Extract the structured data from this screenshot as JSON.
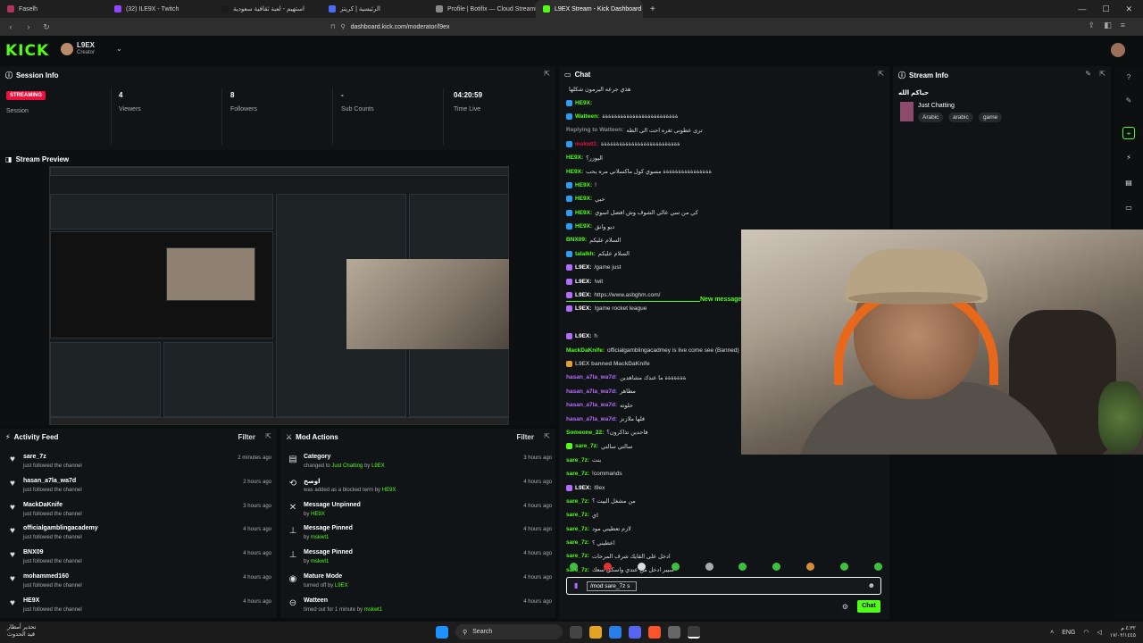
{
  "browser": {
    "tabs": [
      {
        "label": "Faselh",
        "active": false,
        "color": "#b0345e"
      },
      {
        "label": "(32) ILE9X - Twitch",
        "active": false,
        "color": "#9146ff"
      },
      {
        "label": "استهيم - لعبة ثقافية سعودية",
        "active": false,
        "color": "#1a1a1a"
      },
      {
        "label": "الرئيسية | كريتز",
        "active": false,
        "color": "#4a6cf7"
      },
      {
        "label": "Profile | Botifix — Cloud Streaming B",
        "active": false,
        "color": "#888888"
      },
      {
        "label": "L9EX Stream - Kick Dashboard",
        "active": true,
        "color": "#53fc18"
      }
    ],
    "url": "dashboard.kick.com/moderator/l9ex"
  },
  "header": {
    "logo": "KICK",
    "username": "L9EX",
    "role": "Creator"
  },
  "session": {
    "title": "Session Info",
    "badge": "STREAMING",
    "session_label": "Session",
    "stats": [
      {
        "value": "4",
        "label": "Viewers"
      },
      {
        "value": "8",
        "label": "Followers"
      },
      {
        "value": "-",
        "label": "Sub Counts"
      },
      {
        "value": "04:20:59",
        "label": "Time Live"
      }
    ]
  },
  "preview": {
    "title": "Stream Preview"
  },
  "activity": {
    "title": "Activity Feed",
    "filter": "Filter",
    "items": [
      {
        "name": "sare_7z",
        "action": "just followed the channel",
        "time": "2 minutes ago"
      },
      {
        "name": "hasan_a7la_wa7d",
        "action": "just followed the channel",
        "time": "2 hours ago"
      },
      {
        "name": "MackDaKnife",
        "action": "just followed the channel",
        "time": "3 hours ago"
      },
      {
        "name": "officialgamblingacademy",
        "action": "just followed the channel",
        "time": "4 hours ago"
      },
      {
        "name": "BNX09",
        "action": "just followed the channel",
        "time": "4 hours ago"
      },
      {
        "name": "mohammed160",
        "action": "just followed the channel",
        "time": "4 hours ago"
      },
      {
        "name": "HE9X",
        "action": "just followed the channel",
        "time": "4 hours ago"
      }
    ]
  },
  "modactions": {
    "title": "Mod Actions",
    "filter": "Filter",
    "items": [
      {
        "icon": "▤",
        "title": "Category",
        "pre": "changed to",
        "hl": "Just Chatting",
        "mid": "by",
        "by": "L9EX",
        "time": "3 hours ago"
      },
      {
        "icon": "⟲",
        "title": "اوصخ",
        "pre": "was added as a blocked term by",
        "hl": "",
        "mid": "",
        "by": "HE9X",
        "time": "4 hours ago"
      },
      {
        "icon": "✕",
        "title": "Message Unpinned",
        "pre": "by",
        "hl": "",
        "mid": "",
        "by": "HE9X",
        "time": "4 hours ago"
      },
      {
        "icon": "⊥",
        "title": "Message Pinned",
        "pre": "by",
        "hl": "",
        "mid": "",
        "by": "mskwt1",
        "time": "4 hours ago"
      },
      {
        "icon": "⊥",
        "title": "Message Pinned",
        "pre": "by",
        "hl": "",
        "mid": "",
        "by": "mskwt1",
        "time": "4 hours ago"
      },
      {
        "icon": "◉",
        "title": "Mature Mode",
        "pre": "turned off by",
        "hl": "",
        "mid": "",
        "by": "L9EX",
        "time": "4 hours ago"
      },
      {
        "icon": "⊖",
        "title": "Watteen",
        "pre": "timed out for 1 minute by",
        "hl": "",
        "mid": "",
        "by": "mskwt1",
        "time": "4 hours ago"
      }
    ]
  },
  "chat": {
    "title": "Chat",
    "new_messages": "New messages",
    "lines": [
      {
        "user": "",
        "color": "#dddddd",
        "text": "هذي جرعه اليرمون شكلها",
        "badge": ""
      },
      {
        "user": "HE9X:",
        "color": "#53fc18",
        "text": "",
        "badge": "#2a9df4"
      },
      {
        "user": "Watteen:",
        "color": "#53fc18",
        "text": "ةةةةةةةةةةةةةةةةةةةةةةةةة",
        "badge": "#2a9df4"
      },
      {
        "user": "Replying to Watteen:",
        "color": "#888888",
        "text": "ترى عطونى ثغره احت الى الطه",
        "badge": ""
      },
      {
        "user": "mskwt1:",
        "color": "#e9113c",
        "text": "ةةةةةةةةةةةةةةةةةةةةةةةةةة",
        "badge": "#2a9df4"
      },
      {
        "user": "HE9X:",
        "color": "#53fc18",
        "text": "اليوزر؟",
        "badge": ""
      },
      {
        "user": "HE9X:",
        "color": "#53fc18",
        "text": "ةةةةةةةةةةةةةةةة مسوي كول ماكسلاني مره يحب",
        "badge": ""
      },
      {
        "user": "HE9X:",
        "color": "#53fc18",
        "text": "!",
        "badge": "#2a9df4"
      },
      {
        "user": "HE9X:",
        "color": "#53fc18",
        "text": "حبي",
        "badge": "#2a9df4"
      },
      {
        "user": "HE9X:",
        "color": "#53fc18",
        "text": "كي من سي عالي الشوف وش افضل اسوي",
        "badge": "#2a9df4"
      },
      {
        "user": "HE9X:",
        "color": "#53fc18",
        "text": "ديو وانق",
        "badge": "#2a9df4"
      },
      {
        "user": "BNX09:",
        "color": "#53fc18",
        "text": "السلام عليكم",
        "badge": ""
      },
      {
        "user": "talalkh:",
        "color": "#53fc18",
        "text": "السلام عليكم",
        "badge": "#2a9df4"
      },
      {
        "user": "L9EX:",
        "color": "#ffffff",
        "text": "/game just",
        "badge": "#b46cff"
      },
      {
        "user": "L9EX:",
        "color": "#ffffff",
        "text": "!wit",
        "badge": "#b46cff"
      },
      {
        "user": "L9EX:",
        "color": "#ffffff",
        "text": "https://www.asbghm.com/",
        "badge": "#b46cff"
      },
      {
        "user": "L9EX:",
        "color": "#ffffff",
        "text": "!game rocket league",
        "badge": "#b46cff"
      },
      {
        "user": "",
        "color": "#dddddd",
        "text": "",
        "badge": ""
      },
      {
        "user": "L9EX:",
        "color": "#ffffff",
        "text": "h",
        "badge": "#b46cff"
      },
      {
        "user": "MackDaKnife:",
        "color": "#53fc18",
        "text": "officialgamblingacadmey is live come see (Banned)",
        "badge": ""
      },
      {
        "user": "L9EX banned MackDaKnife",
        "color": "#aaaaaa",
        "text": "",
        "badge": "#e0a030"
      },
      {
        "user": "hasan_a7la_wa7d:",
        "color": "#b46cff",
        "text": "ةةةةةةة ما عندك مشاهدين",
        "badge": ""
      },
      {
        "user": "hasan_a7la_wa7d:",
        "color": "#b46cff",
        "text": "مطاهر",
        "badge": ""
      },
      {
        "user": "hasan_a7la_wa7d:",
        "color": "#b46cff",
        "text": "حلوته",
        "badge": ""
      },
      {
        "user": "hasan_a7la_wa7d:",
        "color": "#b46cff",
        "text": "قلها ملازنز",
        "badge": ""
      },
      {
        "user": "Someone_22:",
        "color": "#53fc18",
        "text": "فاحدين تذاكرون؟",
        "badge": ""
      },
      {
        "user": "sare_7z:",
        "color": "#53fc18",
        "text": "سالتي سالتي",
        "badge": "#53fc18"
      },
      {
        "user": "sare_7z:",
        "color": "#53fc18",
        "text": "بنت",
        "badge": ""
      },
      {
        "user": "sare_7z:",
        "color": "#53fc18",
        "text": "!commands",
        "badge": ""
      },
      {
        "user": "L9EX:",
        "color": "#ffffff",
        "text": "l9ex",
        "badge": "#b46cff"
      },
      {
        "user": "sare_7z:",
        "color": "#53fc18",
        "text": "من مشغل البيت ؟",
        "badge": ""
      },
      {
        "user": "sare_7z:",
        "color": "#53fc18",
        "text": "اي",
        "badge": ""
      },
      {
        "user": "sare_7z:",
        "color": "#53fc18",
        "text": "لازم تعطيني مود",
        "badge": ""
      },
      {
        "user": "sare_7z:",
        "color": "#53fc18",
        "text": "اعطيني ؟",
        "badge": ""
      },
      {
        "user": "sare_7z:",
        "color": "#53fc18",
        "text": "ادخل على القايك شرف المرحات",
        "badge": ""
      },
      {
        "user": "sare_7z:",
        "color": "#53fc18",
        "text": "سيبر ادخل من عندي واسكي سعك",
        "badge": ""
      }
    ],
    "input_value": "/mod sare_7z s",
    "send_label": "Chat"
  },
  "streaminfo": {
    "title": "Stream Info",
    "stream_title": "حياكم الله",
    "category": "Just Chatting",
    "tags": [
      "Arabic",
      "arabic",
      "game"
    ]
  },
  "taskbar": {
    "weather_line1": "تحذير أمطار",
    "weather_line2": "قيد الحدوث",
    "search": "Search",
    "lang": "ENG",
    "time": "٤:٣٢ م",
    "date": "١٧/٠٢/١٤٤٥"
  },
  "colors": {
    "accent": "#53fc18",
    "live": "#e9113c"
  }
}
